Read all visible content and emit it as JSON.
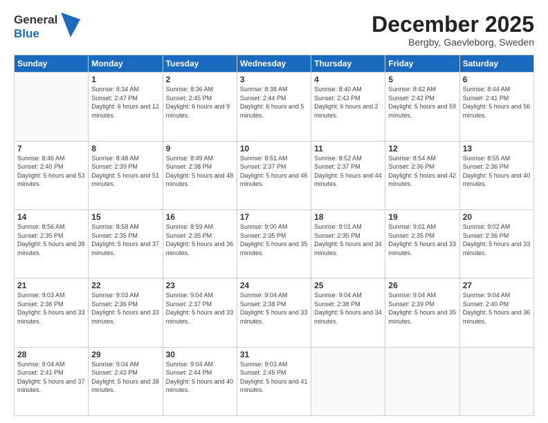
{
  "logo": {
    "line1": "General",
    "line2": "Blue"
  },
  "title": "December 2025",
  "subtitle": "Bergby, Gaevleborg, Sweden",
  "headers": [
    "Sunday",
    "Monday",
    "Tuesday",
    "Wednesday",
    "Thursday",
    "Friday",
    "Saturday"
  ],
  "weeks": [
    [
      {
        "day": "",
        "info": ""
      },
      {
        "day": "1",
        "info": "Sunrise: 8:34 AM\nSunset: 2:47 PM\nDaylight: 6 hours\nand 12 minutes."
      },
      {
        "day": "2",
        "info": "Sunrise: 8:36 AM\nSunset: 2:45 PM\nDaylight: 6 hours\nand 9 minutes."
      },
      {
        "day": "3",
        "info": "Sunrise: 8:38 AM\nSunset: 2:44 PM\nDaylight: 6 hours\nand 5 minutes."
      },
      {
        "day": "4",
        "info": "Sunrise: 8:40 AM\nSunset: 2:43 PM\nDaylight: 6 hours\nand 2 minutes."
      },
      {
        "day": "5",
        "info": "Sunrise: 8:42 AM\nSunset: 2:42 PM\nDaylight: 5 hours\nand 59 minutes."
      },
      {
        "day": "6",
        "info": "Sunrise: 8:44 AM\nSunset: 2:41 PM\nDaylight: 5 hours\nand 56 minutes."
      }
    ],
    [
      {
        "day": "7",
        "info": "Sunrise: 8:46 AM\nSunset: 2:40 PM\nDaylight: 5 hours\nand 53 minutes."
      },
      {
        "day": "8",
        "info": "Sunrise: 8:48 AM\nSunset: 2:39 PM\nDaylight: 5 hours\nand 51 minutes."
      },
      {
        "day": "9",
        "info": "Sunrise: 8:49 AM\nSunset: 2:38 PM\nDaylight: 5 hours\nand 48 minutes."
      },
      {
        "day": "10",
        "info": "Sunrise: 8:51 AM\nSunset: 2:37 PM\nDaylight: 5 hours\nand 46 minutes."
      },
      {
        "day": "11",
        "info": "Sunrise: 8:52 AM\nSunset: 2:37 PM\nDaylight: 5 hours\nand 44 minutes."
      },
      {
        "day": "12",
        "info": "Sunrise: 8:54 AM\nSunset: 2:36 PM\nDaylight: 5 hours\nand 42 minutes."
      },
      {
        "day": "13",
        "info": "Sunrise: 8:55 AM\nSunset: 2:36 PM\nDaylight: 5 hours\nand 40 minutes."
      }
    ],
    [
      {
        "day": "14",
        "info": "Sunrise: 8:56 AM\nSunset: 2:35 PM\nDaylight: 5 hours\nand 38 minutes."
      },
      {
        "day": "15",
        "info": "Sunrise: 8:58 AM\nSunset: 2:35 PM\nDaylight: 5 hours\nand 37 minutes."
      },
      {
        "day": "16",
        "info": "Sunrise: 8:59 AM\nSunset: 2:35 PM\nDaylight: 5 hours\nand 36 minutes."
      },
      {
        "day": "17",
        "info": "Sunrise: 9:00 AM\nSunset: 2:35 PM\nDaylight: 5 hours\nand 35 minutes."
      },
      {
        "day": "18",
        "info": "Sunrise: 9:01 AM\nSunset: 2:35 PM\nDaylight: 5 hours\nand 34 minutes."
      },
      {
        "day": "19",
        "info": "Sunrise: 9:01 AM\nSunset: 2:35 PM\nDaylight: 5 hours\nand 33 minutes."
      },
      {
        "day": "20",
        "info": "Sunrise: 9:02 AM\nSunset: 2:36 PM\nDaylight: 5 hours\nand 33 minutes."
      }
    ],
    [
      {
        "day": "21",
        "info": "Sunrise: 9:03 AM\nSunset: 2:36 PM\nDaylight: 5 hours\nand 33 minutes."
      },
      {
        "day": "22",
        "info": "Sunrise: 9:03 AM\nSunset: 2:36 PM\nDaylight: 5 hours\nand 33 minutes."
      },
      {
        "day": "23",
        "info": "Sunrise: 9:04 AM\nSunset: 2:37 PM\nDaylight: 5 hours\nand 33 minutes."
      },
      {
        "day": "24",
        "info": "Sunrise: 9:04 AM\nSunset: 2:38 PM\nDaylight: 5 hours\nand 33 minutes."
      },
      {
        "day": "25",
        "info": "Sunrise: 9:04 AM\nSunset: 2:38 PM\nDaylight: 5 hours\nand 34 minutes."
      },
      {
        "day": "26",
        "info": "Sunrise: 9:04 AM\nSunset: 2:39 PM\nDaylight: 5 hours\nand 35 minutes."
      },
      {
        "day": "27",
        "info": "Sunrise: 9:04 AM\nSunset: 2:40 PM\nDaylight: 5 hours\nand 36 minutes."
      }
    ],
    [
      {
        "day": "28",
        "info": "Sunrise: 9:04 AM\nSunset: 2:41 PM\nDaylight: 5 hours\nand 37 minutes."
      },
      {
        "day": "29",
        "info": "Sunrise: 9:04 AM\nSunset: 2:43 PM\nDaylight: 5 hours\nand 38 minutes."
      },
      {
        "day": "30",
        "info": "Sunrise: 9:04 AM\nSunset: 2:44 PM\nDaylight: 5 hours\nand 40 minutes."
      },
      {
        "day": "31",
        "info": "Sunrise: 9:03 AM\nSunset: 2:45 PM\nDaylight: 5 hours\nand 41 minutes."
      },
      {
        "day": "",
        "info": ""
      },
      {
        "day": "",
        "info": ""
      },
      {
        "day": "",
        "info": ""
      }
    ]
  ]
}
